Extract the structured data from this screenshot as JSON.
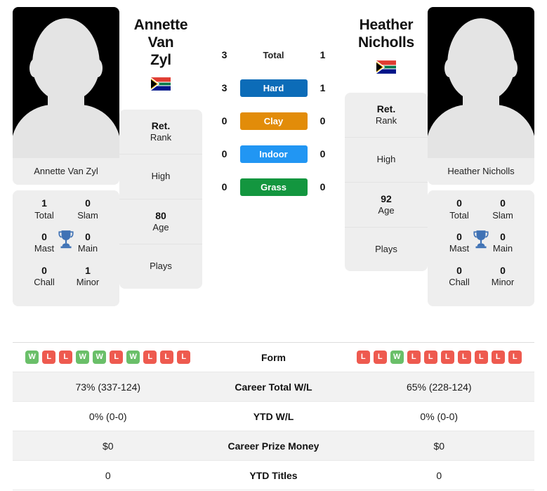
{
  "players": {
    "left": {
      "name_line1": "Annette Van",
      "name_line2": "Zyl",
      "caption": "Annette Van Zyl",
      "flag_icon": "south-africa-flag",
      "titles": {
        "total_val": "1",
        "total_lbl": "Total",
        "slam_val": "0",
        "slam_lbl": "Slam",
        "mast_val": "0",
        "mast_lbl": "Mast",
        "main_val": "0",
        "main_lbl": "Main",
        "chall_val": "0",
        "chall_lbl": "Chall",
        "minor_val": "1",
        "minor_lbl": "Minor"
      },
      "stats": {
        "rank_val": "Ret.",
        "rank_lbl": "Rank",
        "high_val": "",
        "high_lbl": "High",
        "age_val": "80",
        "age_lbl": "Age",
        "plays_val": "",
        "plays_lbl": "Plays"
      },
      "form": [
        "W",
        "L",
        "L",
        "W",
        "W",
        "L",
        "W",
        "L",
        "L",
        "L"
      ],
      "career_total_wl": "73% (337-124)",
      "ytd_wl": "0% (0-0)",
      "career_prize_money": "$0",
      "ytd_titles": "0"
    },
    "right": {
      "name_line1": "Heather",
      "name_line2": "Nicholls",
      "caption": "Heather Nicholls",
      "flag_icon": "south-africa-flag",
      "titles": {
        "total_val": "0",
        "total_lbl": "Total",
        "slam_val": "0",
        "slam_lbl": "Slam",
        "mast_val": "0",
        "mast_lbl": "Mast",
        "main_val": "0",
        "main_lbl": "Main",
        "chall_val": "0",
        "chall_lbl": "Chall",
        "minor_val": "0",
        "minor_lbl": "Minor"
      },
      "stats": {
        "rank_val": "Ret.",
        "rank_lbl": "Rank",
        "high_val": "",
        "high_lbl": "High",
        "age_val": "92",
        "age_lbl": "Age",
        "plays_val": "",
        "plays_lbl": "Plays"
      },
      "form": [
        "L",
        "L",
        "W",
        "L",
        "L",
        "L",
        "L",
        "L",
        "L",
        "L"
      ],
      "career_total_wl": "65% (228-124)",
      "ytd_wl": "0% (0-0)",
      "career_prize_money": "$0",
      "ytd_titles": "0"
    }
  },
  "head_to_head": {
    "rows": [
      {
        "label": "Total",
        "left": "3",
        "right": "1",
        "color": "",
        "style": "plain"
      },
      {
        "label": "Hard",
        "left": "3",
        "right": "1",
        "color": "#0c6cb8",
        "style": "tinted"
      },
      {
        "label": "Clay",
        "left": "0",
        "right": "0",
        "color": "#e28c09",
        "style": "tinted"
      },
      {
        "label": "Indoor",
        "left": "0",
        "right": "0",
        "color": "#2196f3",
        "style": "tinted"
      },
      {
        "label": "Grass",
        "left": "0",
        "right": "0",
        "color": "#13963f",
        "style": "tinted"
      }
    ]
  },
  "comparison_table": {
    "rows": [
      {
        "label": "Form",
        "kind": "form",
        "shaded": false
      },
      {
        "label": "Career Total W/L",
        "kind": "text",
        "shaded": true,
        "key": "career_total_wl"
      },
      {
        "label": "YTD W/L",
        "kind": "text",
        "shaded": false,
        "key": "ytd_wl"
      },
      {
        "label": "Career Prize Money",
        "kind": "text",
        "shaded": true,
        "key": "career_prize_money"
      },
      {
        "label": "YTD Titles",
        "kind": "text",
        "shaded": false,
        "key": "ytd_titles"
      }
    ]
  },
  "colors": {
    "win_badge": "#6abf69",
    "loss_badge": "#ee5a4f",
    "card_bg": "#eeeeee",
    "trophy": "#3f72b5"
  }
}
